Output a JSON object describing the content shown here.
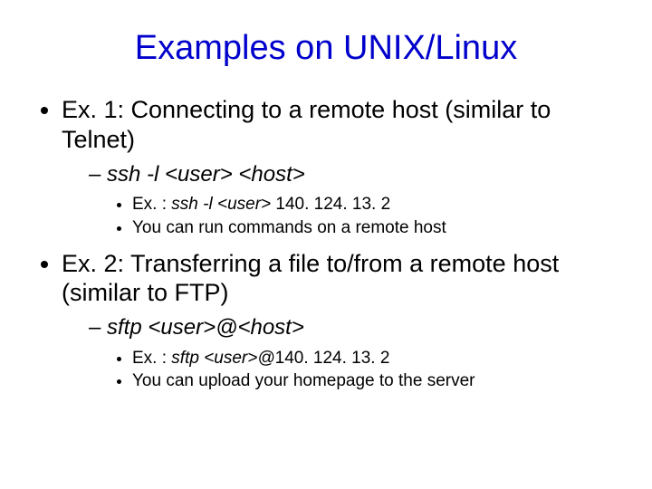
{
  "title": "Examples on UNIX/Linux",
  "ex1": {
    "heading": "Ex. 1: Connecting to a remote host (similar to Telnet)",
    "cmd": "ssh -l <user> <host>",
    "sub_ex_prefix": "Ex. : ",
    "sub_ex_cmd": "ssh -l <user> ",
    "sub_ex_ip": "140. 124. 13. 2",
    "note": "You can run commands on a remote host"
  },
  "ex2": {
    "heading": "Ex. 2: Transferring a file to/from a remote host (similar to FTP)",
    "cmd": "sftp <user>@<host>",
    "sub_ex_prefix": "Ex. : ",
    "sub_ex_cmd": "sftp <user>@",
    "sub_ex_ip": "140. 124. 13. 2",
    "note": "You can upload your homepage to the server"
  }
}
